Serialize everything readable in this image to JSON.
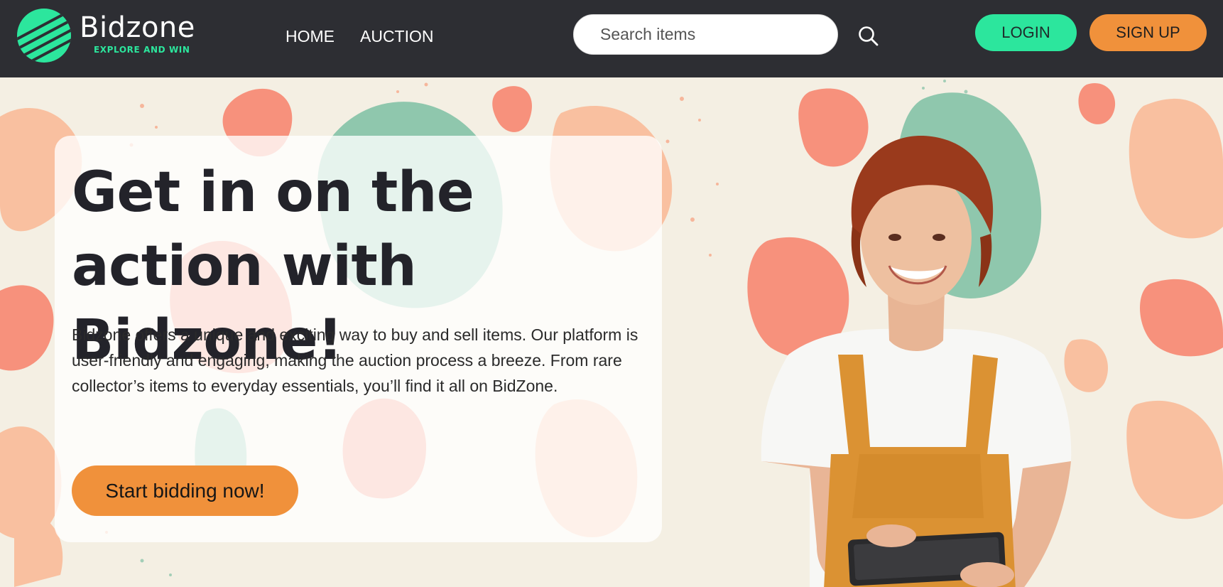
{
  "brand": {
    "name": "Bidzone",
    "tagline": "EXPLORE AND WIN",
    "logo_icon": "striped-circle-logo"
  },
  "nav": {
    "links": [
      {
        "label": "HOME"
      },
      {
        "label": "AUCTION"
      }
    ]
  },
  "search": {
    "placeholder": "Search items",
    "value": "",
    "icon": "search-icon"
  },
  "auth": {
    "login_label": "LOGIN",
    "signup_label": "SIGN UP"
  },
  "hero": {
    "title": "Get in on the action with Bidzone!",
    "description": "Bidzone offers a unique and exciting way to buy and sell items. Our platform is user-friendly and engaging, making the auction process a breeze. From rare collector’s items to everyday essentials, you’ll find it all on BidZone.",
    "cta_label": "Start bidding now!"
  },
  "colors": {
    "navbar_bg": "#2d2e33",
    "accent_green": "#2ce69d",
    "accent_orange": "#f0913b",
    "hero_bg": "#f4efe3",
    "blob_coral": "#f7917c",
    "blob_peach": "#f9c0a0",
    "blob_mint": "#8fc7ad"
  }
}
